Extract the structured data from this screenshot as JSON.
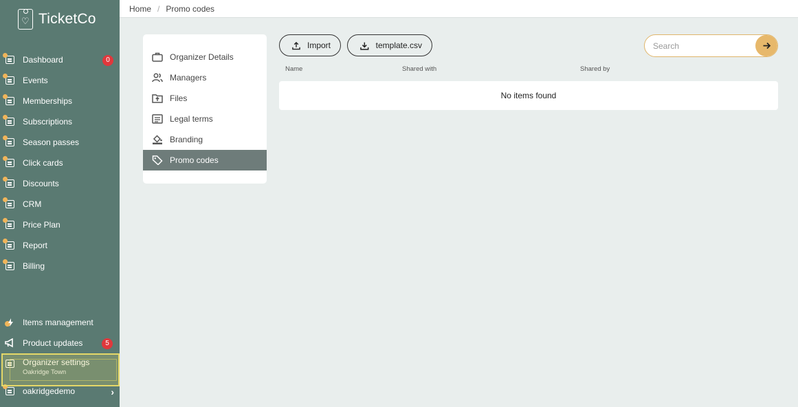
{
  "brand": {
    "name": "TicketCo"
  },
  "sidebar": {
    "items": [
      {
        "label": "Dashboard",
        "icon": "dashboard-icon",
        "badge": "0"
      },
      {
        "label": "Events",
        "icon": "events-icon"
      },
      {
        "label": "Memberships",
        "icon": "memberships-icon"
      },
      {
        "label": "Subscriptions",
        "icon": "subscriptions-icon"
      },
      {
        "label": "Season passes",
        "icon": "season-passes-icon"
      },
      {
        "label": "Click cards",
        "icon": "click-cards-icon"
      },
      {
        "label": "Discounts",
        "icon": "discounts-icon"
      },
      {
        "label": "CRM",
        "icon": "crm-icon"
      },
      {
        "label": "Price Plan",
        "icon": "price-plan-icon"
      },
      {
        "label": "Report",
        "icon": "report-icon"
      },
      {
        "label": "Billing",
        "icon": "billing-icon"
      }
    ],
    "bottom": {
      "items_management": "Items management",
      "product_updates": "Product updates",
      "product_updates_badge": "5",
      "organizer_settings": "Organizer settings",
      "organizer_name": "Oakridge Town",
      "user": "oakridgedemo"
    }
  },
  "breadcrumb": {
    "home": "Home",
    "separator": "/",
    "current": "Promo codes"
  },
  "settings_menu": {
    "items": [
      {
        "label": "Organizer Details",
        "icon": "briefcase-icon"
      },
      {
        "label": "Managers",
        "icon": "users-icon"
      },
      {
        "label": "Files",
        "icon": "folder-upload-icon"
      },
      {
        "label": "Legal terms",
        "icon": "document-icon"
      },
      {
        "label": "Branding",
        "icon": "paint-bucket-icon"
      },
      {
        "label": "Promo codes",
        "icon": "tag-icon",
        "active": true
      }
    ]
  },
  "toolbar": {
    "import_label": "Import",
    "template_label": "template.csv",
    "search_placeholder": "Search",
    "search_value": ""
  },
  "table": {
    "columns": [
      "Name",
      "Shared with",
      "Shared by"
    ],
    "empty_message": "No items found"
  },
  "colors": {
    "sidebar_bg": "#5a7a72",
    "accent": "#e7b86b",
    "badge": "#e0383c",
    "active_menu": "#6e7c7a",
    "page_bg": "#e9eeed"
  }
}
